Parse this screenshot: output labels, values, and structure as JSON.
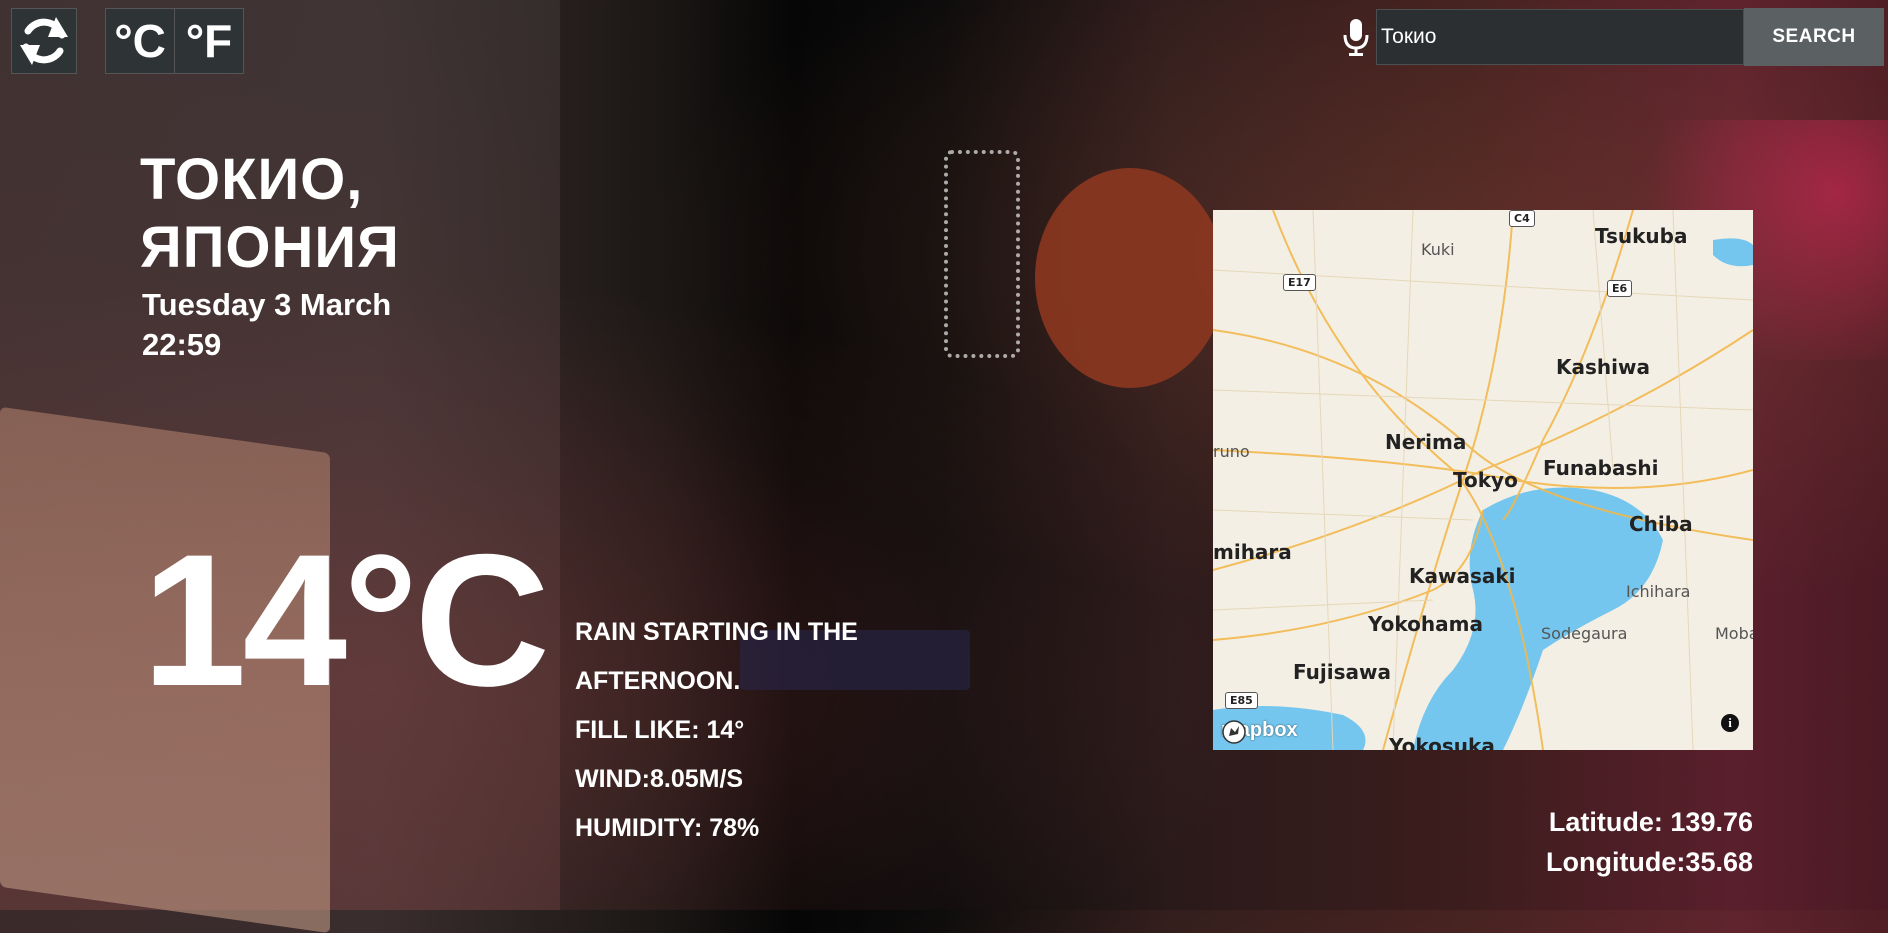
{
  "controls": {
    "refresh_icon": "refresh-icon",
    "celsius_label": "°C",
    "fahrenheit_label": "°F"
  },
  "search": {
    "mic_icon": "microphone-icon",
    "value": "Токио",
    "button_label": "SEARCH"
  },
  "location": {
    "city": "ТОКИО, ЯПОНИЯ",
    "date": "Tuesday 3 March",
    "time": "22:59"
  },
  "weather": {
    "temperature": "14°C",
    "summary": "RAIN STARTING IN THE AFTERNOON.",
    "feels_like": "FILL LIKE: 14°",
    "wind": "WIND:8.05M/S",
    "humidity": "HUMIDITY: 78%"
  },
  "map": {
    "labels_big": [
      "Tsukuba",
      "Kashiwa",
      "Nerima",
      "Tokyo",
      "Funabashi",
      "Chiba",
      "Kawasaki",
      "Yokohama",
      "Fujisawa",
      "Yokosuka",
      "mihara"
    ],
    "labels_small": [
      "Kuki",
      "runo",
      "Ichihara",
      "Sodegaura",
      "Moba"
    ],
    "road_badges": [
      "C4",
      "E17",
      "E6",
      "E85"
    ],
    "logo_text": "mapbox",
    "info_icon": "info-icon"
  },
  "coordinates": {
    "latitude": "Latitude: 139.76",
    "longitude": "Longitude:35.68"
  }
}
